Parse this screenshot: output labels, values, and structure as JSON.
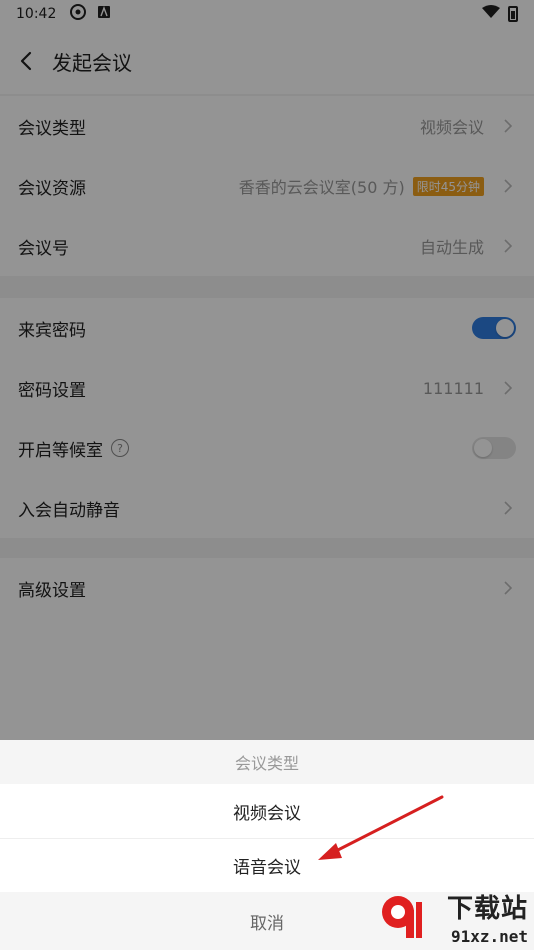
{
  "statusbar": {
    "time": "10:42"
  },
  "nav": {
    "title": "发起会议"
  },
  "group1": [
    {
      "label": "会议类型",
      "value": "视频会议"
    },
    {
      "label": "会议资源",
      "value": "香香的云会议室(50 方)",
      "badge": "限时45分钟"
    },
    {
      "label": "会议号",
      "value": "自动生成"
    }
  ],
  "group2": [
    {
      "label": "来宾密码",
      "toggle": true
    },
    {
      "label": "密码设置",
      "value": "111111"
    },
    {
      "label": "开启等候室",
      "help": "?",
      "toggle": false
    },
    {
      "label": "入会自动静音"
    }
  ],
  "group3": [
    {
      "label": "高级设置"
    }
  ],
  "sheet": {
    "title": "会议类型",
    "options": [
      "视频会议",
      "语音会议"
    ],
    "cancel": "取消"
  },
  "watermark": {
    "line1": "下载站",
    "line2": "91xz.net"
  },
  "colors": {
    "accent": "#2f7de1",
    "badge": "#f0a020",
    "annotation_arrow": "#d62020"
  }
}
